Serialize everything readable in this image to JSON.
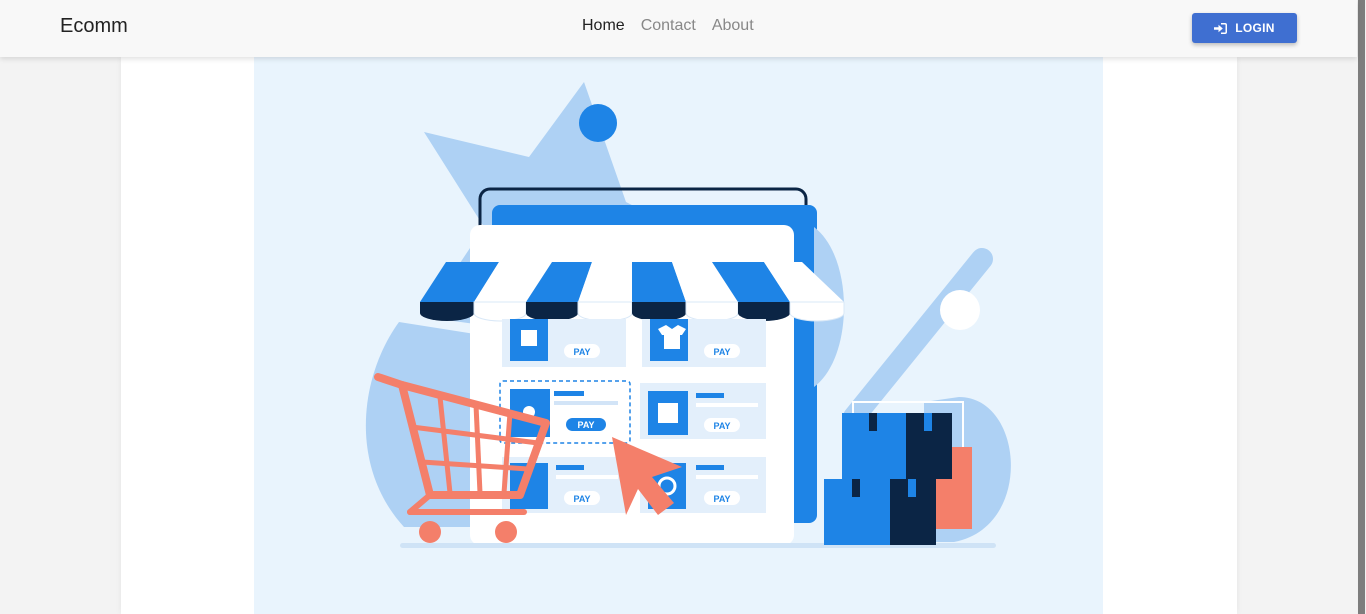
{
  "navbar": {
    "brand": "Ecomm",
    "links": [
      {
        "label": "Home",
        "active": true
      },
      {
        "label": "Contact",
        "active": false
      },
      {
        "label": "About",
        "active": false
      }
    ],
    "login_label": "LOGIN",
    "login_icon": "login-icon"
  },
  "hero": {
    "illustration": "online-shop-illustration",
    "pay_labels": [
      "PAY",
      "PAY",
      "PAY",
      "PAY",
      "PAY",
      "PAY"
    ]
  },
  "colors": {
    "accent": "#3f6fd1",
    "illustration_blue": "#1e84e6",
    "illustration_navy": "#0b2545",
    "illustration_coral": "#f47f6a",
    "illustration_light_blue": "#aed1f4",
    "hero_background": "#e9f4fd"
  }
}
